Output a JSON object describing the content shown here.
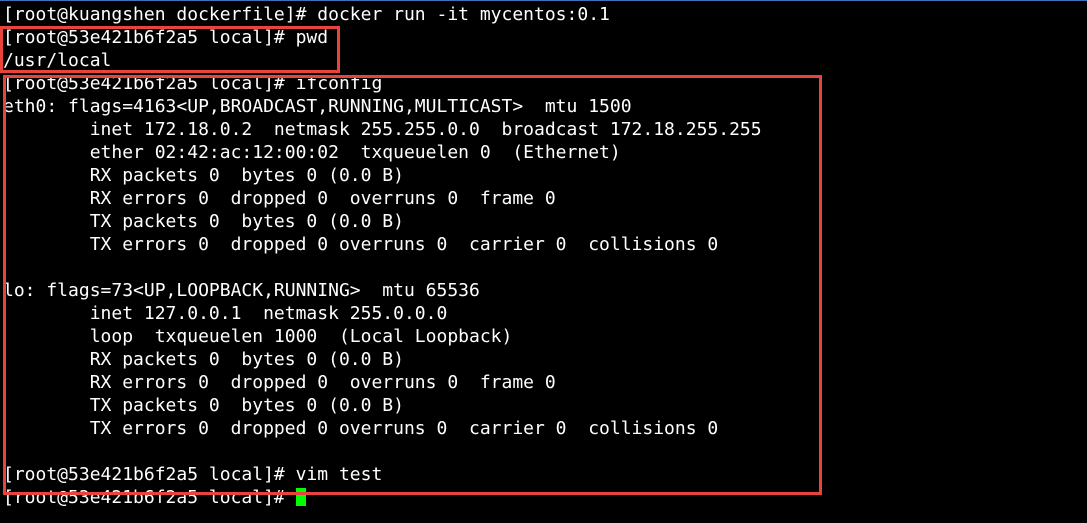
{
  "terminal": {
    "lines": [
      "[root@kuangshen dockerfile]# docker run -it mycentos:0.1",
      "[root@53e421b6f2a5 local]# pwd",
      "/usr/local",
      "[root@53e421b6f2a5 local]# ifconfig",
      "eth0: flags=4163<UP,BROADCAST,RUNNING,MULTICAST>  mtu 1500",
      "        inet 172.18.0.2  netmask 255.255.0.0  broadcast 172.18.255.255",
      "        ether 02:42:ac:12:00:02  txqueuelen 0  (Ethernet)",
      "        RX packets 0  bytes 0 (0.0 B)",
      "        RX errors 0  dropped 0  overruns 0  frame 0",
      "        TX packets 0  bytes 0 (0.0 B)",
      "        TX errors 0  dropped 0 overruns 0  carrier 0  collisions 0",
      "",
      "lo: flags=73<UP,LOOPBACK,RUNNING>  mtu 65536",
      "        inet 127.0.0.1  netmask 255.0.0.0",
      "        loop  txqueuelen 1000  (Local Loopback)",
      "        RX packets 0  bytes 0 (0.0 B)",
      "        RX errors 0  dropped 0  overruns 0  frame 0",
      "        TX packets 0  bytes 0 (0.0 B)",
      "        TX errors 0  dropped 0 overruns 0  carrier 0  collisions 0",
      "",
      "[root@53e421b6f2a5 local]# vim test",
      "[root@53e421b6f2a5 local]# "
    ]
  },
  "colors": {
    "background": "#000000",
    "text": "#ffffff",
    "cursor": "#00ff00",
    "highlight_box": "#e8433d"
  }
}
